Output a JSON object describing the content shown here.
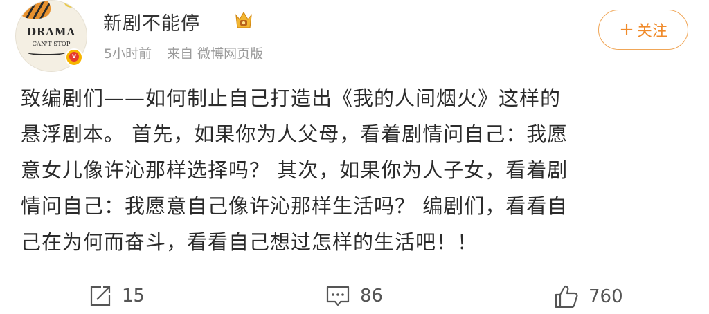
{
  "profile": {
    "username": "新剧不能停",
    "avatar_line1": "DRAMA",
    "avatar_line2": "CAN'T STOP",
    "badge_letter": "v"
  },
  "meta": {
    "time": "5小时前",
    "source": "来自 微博网页版"
  },
  "follow": {
    "plus": "+",
    "label": "关注"
  },
  "post": {
    "lines": [
      "致编剧们——如何制止自己打造出《我的人间烟火》这样的",
      "悬浮剧本。 首先，如果你为人父母，看着剧情问自己：我愿",
      "意女儿像许沁那样选择吗？ 其次，如果你为人子女，看着剧",
      "情问自己：我愿意自己像许沁那样生活吗？ 编剧们，看看自",
      "己在为何而奋斗，看看自己想过怎样的生活吧！！"
    ]
  },
  "actions": {
    "repost_count": "15",
    "comment_count": "86",
    "like_count": "760"
  },
  "colors": {
    "accent": "#f08b2b",
    "meta_text": "#9b9b9b",
    "body_text": "#2b2b2b"
  }
}
